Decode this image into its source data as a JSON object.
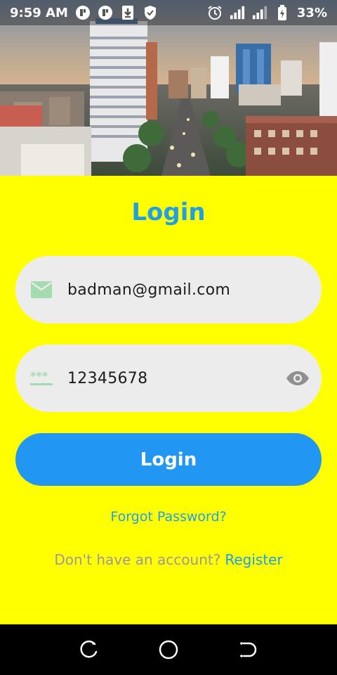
{
  "status_bar": {
    "time": "9:59 AM",
    "battery": "33%",
    "icons_left": [
      "app-icon",
      "app-icon",
      "download-icon",
      "shield-icon"
    ],
    "icons_right": [
      "alarm-icon",
      "signal-icon",
      "signal-icon",
      "battery-icon"
    ]
  },
  "hero": {
    "image": "city-skyline-photo"
  },
  "login": {
    "title": "Login",
    "email": {
      "value": "badman@gmail.com",
      "icon": "mail-icon"
    },
    "password": {
      "value": "12345678",
      "icon": "password-icon",
      "toggle_icon": "eye-icon"
    },
    "button_label": "Login",
    "forgot_password": "Forgot Password?",
    "register_prompt": "Don't have an account?",
    "register_link": "Register"
  },
  "colors": {
    "background": "#ffff00",
    "accent": "#1ea0e8",
    "button": "#2196f3",
    "field": "#ececec",
    "icon_green": "#a3dab0"
  },
  "nav_bar": {
    "buttons": [
      "recents-icon",
      "home-icon",
      "back-icon"
    ]
  }
}
